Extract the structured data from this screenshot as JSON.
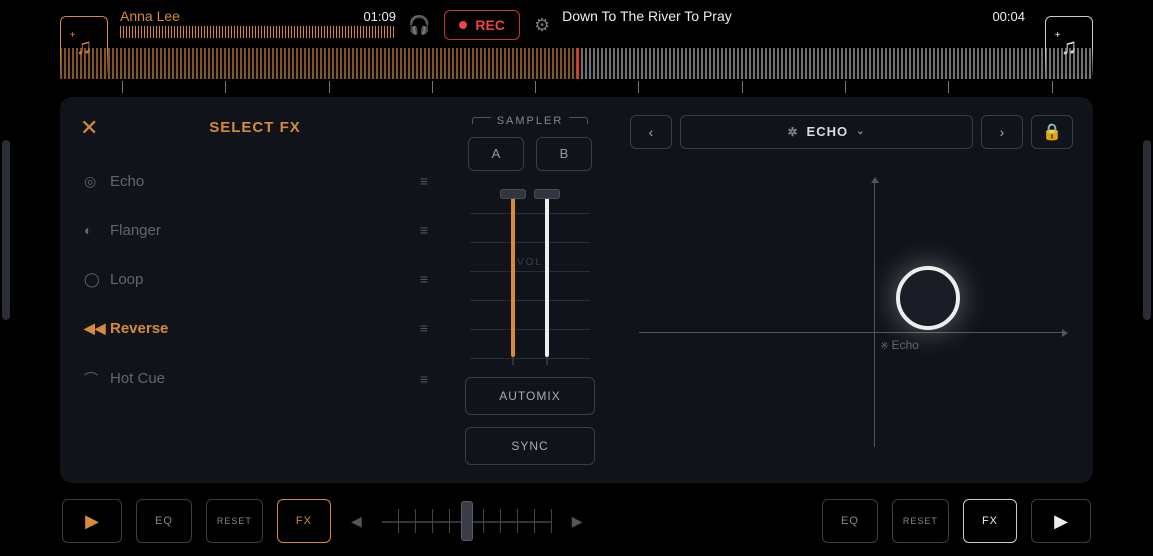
{
  "header": {
    "deck_a": {
      "title": "Anna Lee",
      "time": "01:09"
    },
    "deck_b": {
      "title": "Down To The River To Pray",
      "time": "00:04"
    },
    "rec_label": "REC"
  },
  "fx_panel": {
    "title": "SELECT FX",
    "items": [
      {
        "icon": "◎",
        "label": "Echo",
        "active": false
      },
      {
        "icon": "◐",
        "label": "Flanger",
        "active": false
      },
      {
        "icon": "◯",
        "label": "Loop",
        "active": false
      },
      {
        "icon": "◀◀",
        "label": "Reverse",
        "active": true
      },
      {
        "icon": "⌒",
        "label": "Hot Cue",
        "active": false
      }
    ]
  },
  "sampler": {
    "title": "SAMPLER",
    "a_label": "A",
    "b_label": "B",
    "vol_label": "VOL",
    "automix_label": "AUTOMIX",
    "sync_label": "SYNC"
  },
  "xy": {
    "effect_name": "ECHO",
    "axis_label": "Echo"
  },
  "bottom": {
    "eq_label": "EQ",
    "reset_label": "RESET",
    "fx_label": "FX"
  }
}
